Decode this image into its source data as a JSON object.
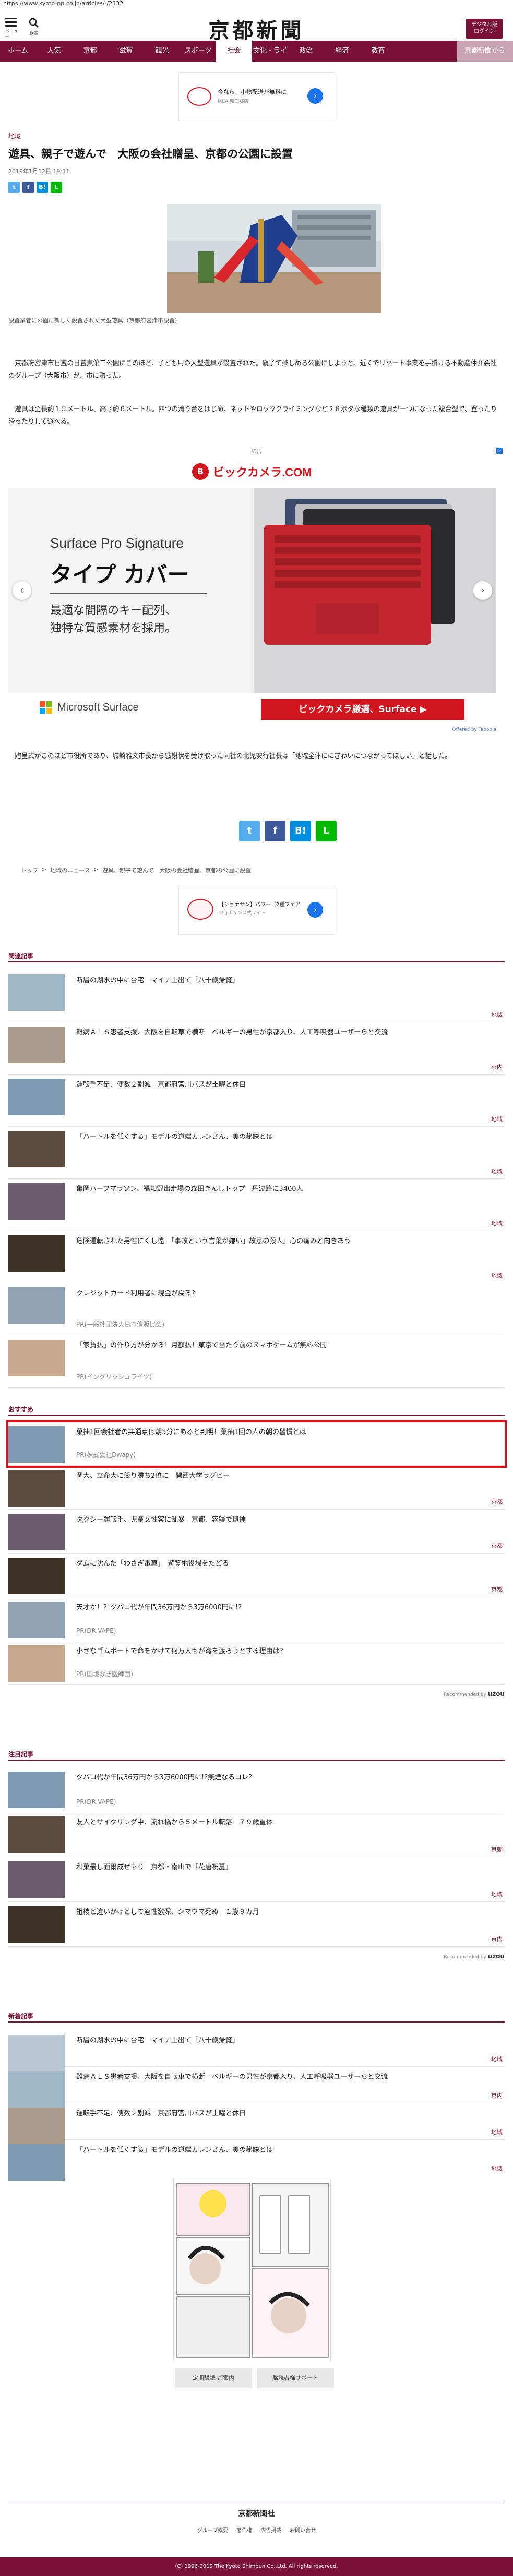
{
  "url": "https://www.kyoto-np.co.jp/articles/-/2132",
  "header": {
    "menu_label": "メニュー",
    "search_label": "検索",
    "logo": "京都新聞",
    "digital_button": "デジタル版\nログイン"
  },
  "nav": {
    "items": [
      "ホーム",
      "人気",
      "京都",
      "滋賀",
      "観光",
      "スポーツ",
      "社会",
      "文化・ライフ",
      "政治",
      "経済",
      "教育",
      "京都新聞から"
    ],
    "active_index": 6
  },
  "top_ad": {
    "text": "今なら、小物配送が無料に",
    "sub": "IKEA 新三郷店"
  },
  "article": {
    "category": "地域",
    "title": "遊具、親子で遊んで　大阪の会社贈呈、京都の公園に設置",
    "date": "2019年1月12日 19:11",
    "share": [
      "t",
      "f",
      "B!",
      "L"
    ],
    "caption": "設置業者に公園に新しく設置された大型遊具（京都府宮津市設置）",
    "paragraphs": [
      "　京都府宮津市日置の日置東第二公園にこのほど、子ども用の大型遊具が設置された。親子で楽しめる公園にしようと、近くでリゾート事業を手掛ける不動産仲介会社のグループ（大阪市）が、市に贈った。",
      "　遊具は全長約１５メートル、高さ約６メートル。四つの滑り台をはじめ、ネットやロッククライミングなど２８ボタな種類の遊具が一つになった複合型で、登ったり滑ったりして遊べる。"
    ],
    "paragraph_end": "　贈呈式がこのほど市役所であり、城崎雅文市長から感謝状を受け取った同社の北児安行社長は「地域全体ににぎわいにつながってほしい」と話した。"
  },
  "big_ad": {
    "pr_label": "広告",
    "brand": "ビックカメラ.COM",
    "headline_en": "Surface Pro Signature",
    "headline_jp": "タイプ カバー",
    "body": "最適な間隔のキー配列、\n独特な質感素材を採用。",
    "ms_brand": "Microsoft Surface",
    "cta": "ビックカメラ厳選、Surface ▶",
    "credit": "Offered by Taboola"
  },
  "breadcrumb": [
    "トップ",
    ">",
    "地域のニュース",
    ">",
    "遊具、親子で遊んで　大阪の会社贈呈、京都の公園に設置"
  ],
  "mid_ad": {
    "text": "【ジョナサン】パワー（2種フェア",
    "sub": "ジョナサン公式サイト"
  },
  "related": {
    "heading": "関連記事",
    "items": [
      {
        "title": "断層の湖水の中に台宅　マイナ上出て「八十歳帰覧」",
        "cat": "地域"
      },
      {
        "title": "難病ＡＬＳ患者支援、大阪を自転車で横断　ベルギーの男性が京都入り、人工呼吸器ユーザーらと交流",
        "cat": "京内"
      },
      {
        "title": "運転手不足、便数２割減　京都府宮川バスが土曜と休日",
        "cat": "地域"
      },
      {
        "title": "「ハードルを低くする」モデルの道端カレンさん、美の秘訣とは",
        "cat": "地域"
      },
      {
        "title": "亀岡ハーフマラソン、福知野出走場の森田きんしトップ　丹波路に3400人",
        "cat": "地域"
      },
      {
        "title": "危険運転された男性にくし遠　「事故という言葉が嫌い」故意の殺人」心の痛みと向きあう",
        "cat": "地域"
      },
      {
        "title": "クレジットカード利用者に現金が戻る？",
        "sponsor": "PR(一般社団法人日本信販協会)"
      },
      {
        "title": "「家賃払」の作り方が分かる！月額払！東京で当たり前のスマホゲームが無料公開",
        "sponsor": "PR(イングリッシュライツ)"
      }
    ]
  },
  "recommended": {
    "heading": "おすすめ",
    "items": [
      {
        "title": "菓抽1回会社者の共通点は朝5分にあると判明！菓抽1回の人の朝の習慣とは",
        "sponsor": "PR(株式会社Dwapy)"
      },
      {
        "title": "岡大、立命大に競り勝ち2位に　関西大学ラグビー",
        "cat": "京都"
      },
      {
        "title": "タクシー運転手、児童女性客に乱暴　京都、容疑で逮捕",
        "cat": "京都"
      },
      {
        "title": "ダムに沈んだ「わさぎ電車」　遊覧地役場をたどる",
        "cat": "京都"
      },
      {
        "title": "天才か！？タバコ代が年間36万円から3万6000円に!?",
        "sponsor": "PR(DR.VAPE)"
      },
      {
        "title": "小さなゴムボートで命をかけて何万人もが海を渡ろうとする理由は？",
        "sponsor": "PR(国境なき医師団)"
      }
    ],
    "credit": "Recommended by",
    "credit_brand": "uzou"
  },
  "popular": {
    "heading": "注目記事",
    "items": [
      {
        "title": "タバコ代が年間36万円から3万6000円に!?無煙なるコレ？",
        "sponsor": "PR(DR.VAPE)"
      },
      {
        "title": "友人とサイクリング中、流れ橋から５メートル転落　７９歳重体",
        "cat": "京都"
      },
      {
        "title": "和菓最し面爾成ぜもり　京都・南山で「花唐祝夏」",
        "cat": "地域"
      },
      {
        "title": "祖楼と違いかけとして適性激深、シマウマ死ぬ　１歳９カ月",
        "cat": "京内"
      }
    ],
    "credit": "Recommended by",
    "credit_brand": "uzou"
  },
  "news": {
    "heading": "新着記事",
    "items": [
      {
        "title": "断層の湖水の中に台宅　マイナ上出て「八十歳帰覧」",
        "cat": "地域"
      },
      {
        "title": "難病ＡＬＳ患者支援、大阪を自転車で横断　ベルギーの男性が京都入り、人工呼吸器ユーザーらと交流",
        "cat": "京内"
      },
      {
        "title": "運転手不足、便数２割減　京都府宮川バスが土曜と休日",
        "cat": "地域"
      },
      {
        "title": "「ハードルを低くする」モデルの道端カレンさん、美の秘訣とは",
        "cat": "地域"
      }
    ]
  },
  "footer": {
    "buttons": [
      "定期購読 ご案内",
      "購読者様サポート"
    ],
    "logo": "京都新聞社",
    "links": [
      "グループ概要",
      "著作権",
      "広告掲載",
      "お問い合せ"
    ],
    "copyright": "(C) 1996-2019 The Kyoto Shimbun Co.,Ltd. All rights reserved."
  },
  "colors": {
    "brand": "#7a1238",
    "highlight": "#e0121c",
    "twitter": "#55acee",
    "facebook": "#3b5998",
    "hatena": "#008fde",
    "line": "#00b900"
  }
}
